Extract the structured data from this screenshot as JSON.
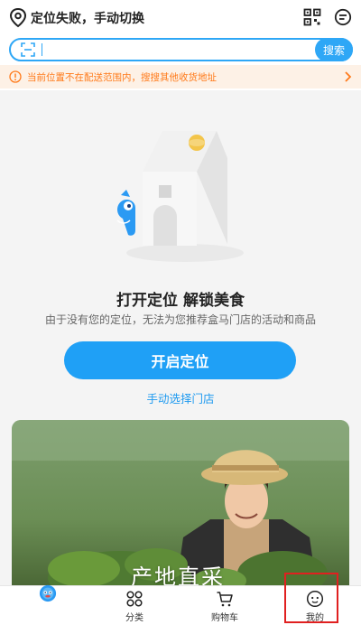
{
  "header": {
    "location_text": "定位失败，手动切换",
    "icons": [
      "map-pin-icon",
      "qr-code-icon",
      "message-icon"
    ]
  },
  "search": {
    "placeholder": "",
    "value": "",
    "button_label": "搜索"
  },
  "notice": {
    "text": "当前位置不在配送范围内，搜搜其他收货地址"
  },
  "main": {
    "title": "打开定位 解锁美食",
    "description": "由于没有您的定位，无法为您推荐盒马门店的活动和商品",
    "primary_button": "开启定位",
    "secondary_link": "手动选择门店"
  },
  "banner": {
    "text": "产地直采"
  },
  "tabbar": {
    "items": [
      {
        "label": "",
        "icon": "home-mascot-icon"
      },
      {
        "label": "分类",
        "icon": "category-icon"
      },
      {
        "label": "购物车",
        "icon": "cart-icon"
      },
      {
        "label": "我的",
        "icon": "profile-icon"
      }
    ]
  },
  "colors": {
    "brand_blue": "#1fa0f6",
    "notice_orange": "#ff7a1a",
    "notice_bg": "#fdf1e6",
    "highlight_red": "#e02020"
  }
}
